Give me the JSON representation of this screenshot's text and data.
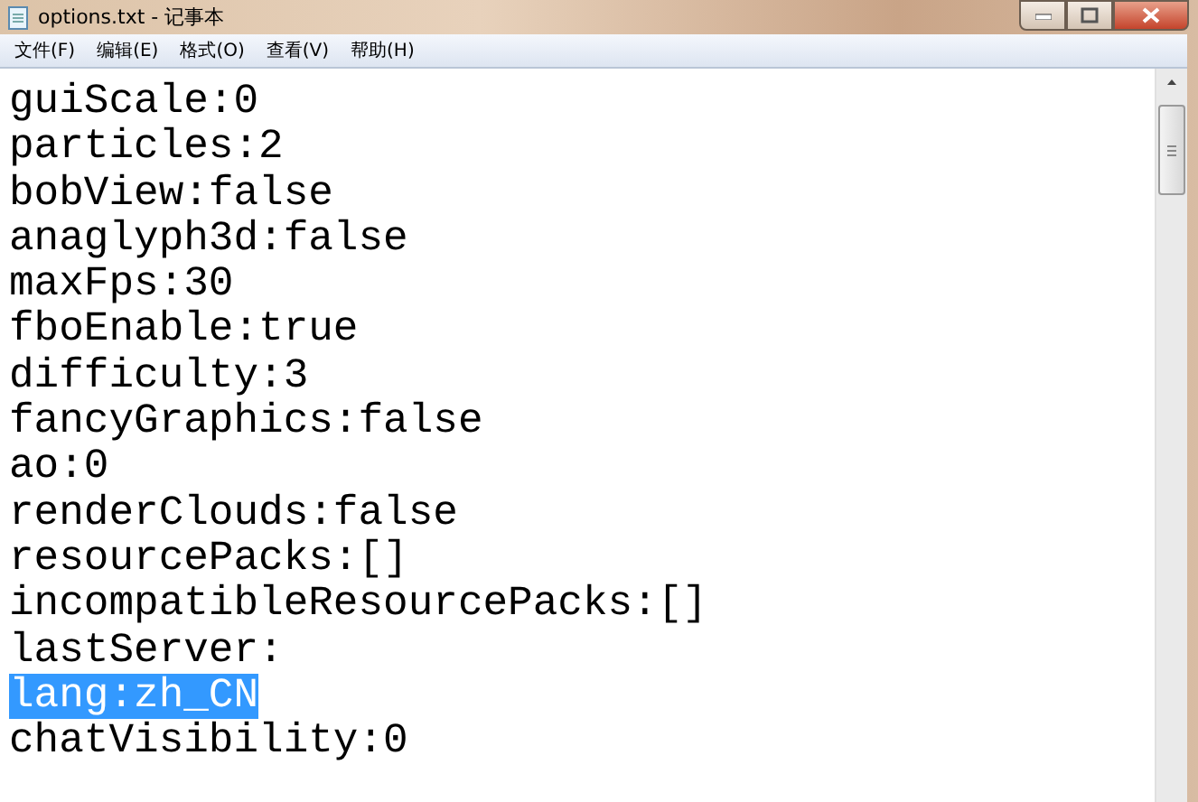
{
  "window": {
    "title": "options.txt - 记事本"
  },
  "menu": [
    {
      "label": "文件(F)"
    },
    {
      "label": "编辑(E)"
    },
    {
      "label": "格式(O)"
    },
    {
      "label": "查看(V)"
    },
    {
      "label": "帮助(H)"
    }
  ],
  "lines": [
    {
      "text": "guiScale:0",
      "selected": false
    },
    {
      "text": "particles:2",
      "selected": false
    },
    {
      "text": "bobView:false",
      "selected": false
    },
    {
      "text": "anaglyph3d:false",
      "selected": false
    },
    {
      "text": "maxFps:30",
      "selected": false
    },
    {
      "text": "fboEnable:true",
      "selected": false
    },
    {
      "text": "difficulty:3",
      "selected": false
    },
    {
      "text": "fancyGraphics:false",
      "selected": false
    },
    {
      "text": "ao:0",
      "selected": false
    },
    {
      "text": "renderClouds:false",
      "selected": false
    },
    {
      "text": "resourcePacks:[]",
      "selected": false
    },
    {
      "text": "incompatibleResourcePacks:[]",
      "selected": false
    },
    {
      "text": "lastServer:",
      "selected": false
    },
    {
      "text": "lang:zh_CN",
      "selected": true
    },
    {
      "text": "chatVisibility:0",
      "selected": false
    }
  ]
}
